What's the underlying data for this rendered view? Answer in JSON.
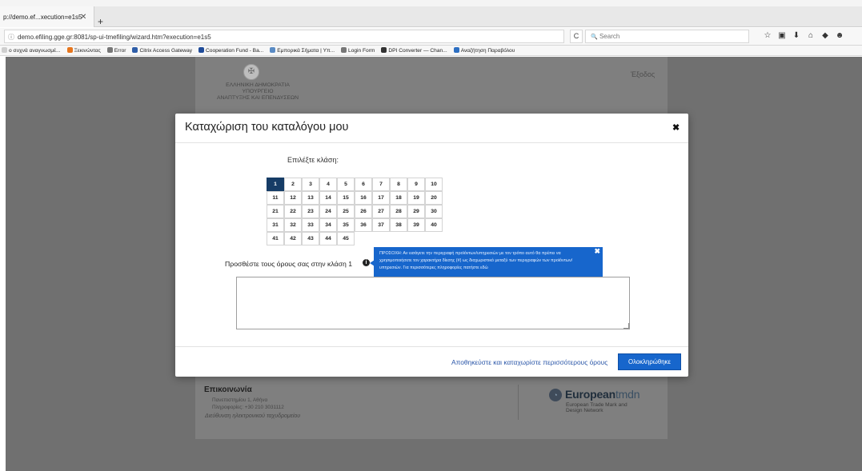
{
  "browser": {
    "top_strip_text": "",
    "tab": {
      "title": "p://demo.ef...xecution=e1s5",
      "close": "✕"
    },
    "new_tab": "+",
    "address": {
      "info_icon": "ⓘ",
      "url": "demo.efiling.gge.gr:8081/sp-ui-tmefiling/wizard.htm?execution=e1s5"
    },
    "reload": "C",
    "search": {
      "placeholder": "Search",
      "icon": "🔍"
    },
    "toolbar_icons": [
      "☆",
      "▣",
      "⬇",
      "⌂",
      "◆",
      "☻"
    ],
    "bookmarks": [
      {
        "label": "ο συχνά αναγνωσμέ...",
        "icon_color": "#cfcfcf"
      },
      {
        "label": "Ξεκινώντας",
        "icon_color": "#e6761d"
      },
      {
        "label": "Error",
        "icon_color": "#777777"
      },
      {
        "label": "Citrix Access Gateway",
        "icon_color": "#2f5ea8"
      },
      {
        "label": "Cooperation Fund - Ba...",
        "icon_color": "#1f4b99"
      },
      {
        "label": "Εμπορικά Σήματα | Υπ...",
        "icon_color": "#5a8bc4"
      },
      {
        "label": "Login Form",
        "icon_color": "#777777"
      },
      {
        "label": "DPI Converter — Chan...",
        "icon_color": "#333333"
      },
      {
        "label": "Αναζήτηση Παραβόλου",
        "icon_color": "#2d6fc2"
      }
    ]
  },
  "page": {
    "gov": {
      "emblem": "✠",
      "lines": [
        "ΕΛΛΗΝΙΚΗ ΔΗΜΟΚΡΑΤΙΑ",
        "ΥΠΟΥΡΓΕΙΟ",
        "ΑΝΑΠΤΥΞΗΣ ΚΑΙ ΕΠΕΝΔΥΣΕΩΝ"
      ]
    },
    "exit_label": "Έξοδος",
    "footer": {
      "contact_title": "Επικοινωνία",
      "contact_lines": [
        "Πανεπιστημίου 1, Αθήνα",
        "Πληροφορίες: +30 210 3031112"
      ],
      "contact_link": "Διεύθυνση ηλεκτρονικού ταχυδρομείου",
      "etm": {
        "logo": "◔",
        "name_bold": "European",
        "name_light": "tmdn",
        "subtitle": [
          "European Trade Mark and",
          "Design Network"
        ]
      }
    }
  },
  "modal": {
    "title": "Καταχώριση του καταλόγου μου",
    "close": "✖",
    "choose_label": "Επιλέξτε κλάση:",
    "active_class": 1,
    "classes": [
      1,
      2,
      3,
      4,
      5,
      6,
      7,
      8,
      9,
      10,
      11,
      12,
      13,
      14,
      15,
      16,
      17,
      18,
      19,
      20,
      21,
      22,
      23,
      24,
      25,
      26,
      27,
      28,
      29,
      30,
      31,
      32,
      33,
      34,
      35,
      36,
      37,
      38,
      39,
      40,
      41,
      42,
      43,
      44,
      45
    ],
    "terms_label": "Προσθέστε τους όρους σας στην κλάση 1",
    "info_icon": "i",
    "tooltip": {
      "text": "ΠΡΟΣΟΧΗ: Αν εισάγετε την περιγραφή προϊόντων/υπηρεσιών με τον τρόπο αυτό θα πρέπει να χρησιμοποιήσετε τον χαρακτήρα δίεσης (#) ως διαχωριστικό μεταξύ των περιγραφών των προϊόντων/υπηρεσιών. Για περισσότερες πληροφορίες πατήστε εδώ",
      "close": "✖"
    },
    "terms_value": "",
    "save_more": "Αποθηκεύστε και καταχωρίστε περισσότερους όρους",
    "complete": "Ολοκληρώθηκε"
  }
}
